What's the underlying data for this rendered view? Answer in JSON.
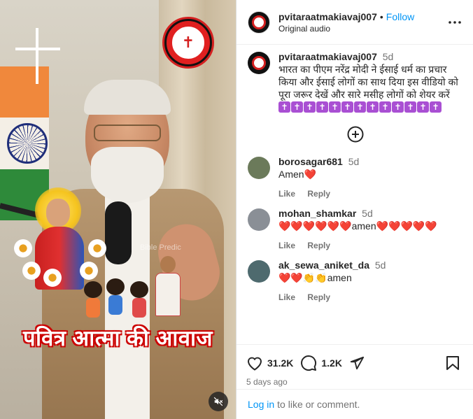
{
  "media": {
    "watermark": "Bible Predic",
    "caption": "पवित्र आत्मा की आवाज",
    "logo_text": "पवित्र आत्मा की आवाज",
    "mute_icon": "speaker-muted-icon"
  },
  "header": {
    "username": "pvitaraatmakiavaj007",
    "separator": "•",
    "follow_label": "Follow",
    "subtitle": "Original audio"
  },
  "post": {
    "username": "pvitaraatmakiavaj007",
    "time": "5d",
    "text": "भारत का पीएम नरेंद्र मोदी ने ईसाई धर्म का प्रचार किया और ईसाई लोगों का साथ दिया इस वीडियो को पूरा जरूर देखें और सारे मसीह लोगों को शेयर करें",
    "crosses": [
      "✝",
      "✝",
      "✝",
      "✝",
      "✝",
      "✝",
      "✝",
      "✝",
      "✝",
      "✝",
      "✝",
      "✝",
      "✝"
    ]
  },
  "comments": [
    {
      "username": "borosagar681",
      "time": "5d",
      "text": "Amen❤️",
      "like_label": "Like",
      "reply_label": "Reply",
      "avatar_color": "#6b7a5a"
    },
    {
      "username": "mohan_shamkar",
      "time": "5d",
      "text": "❤️❤️❤️❤️❤️❤️amen❤️❤️❤️❤️❤️",
      "like_label": "Like",
      "reply_label": "Reply",
      "avatar_color": "#8a8f96"
    },
    {
      "username": "ak_sewa_aniket_da",
      "time": "5d",
      "text": "❤️❤️👏👏amen",
      "like_label": "Like",
      "reply_label": "Reply",
      "avatar_color": "#4e6a6e"
    }
  ],
  "actions": {
    "likes": "31.2K",
    "comments": "1.2K",
    "posted": "5 days ago"
  },
  "login": {
    "link_label": "Log in",
    "rest": "to like or comment."
  },
  "colors": {
    "link": "#0095f6",
    "secondary": "#737373",
    "cross_bg": "#a94fd3"
  }
}
